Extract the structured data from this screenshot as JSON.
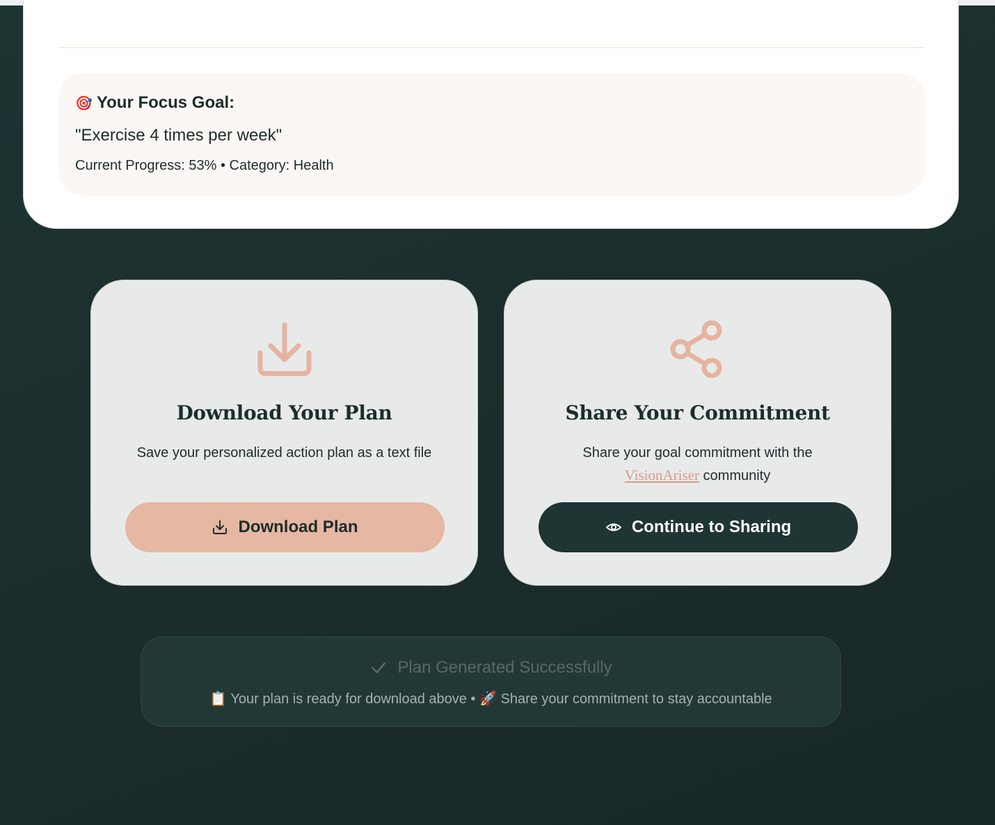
{
  "focus_goal": {
    "heading": "Your Focus Goal:",
    "dart_glyph": "🎯",
    "quote": "\"Exercise 4 times per week\"",
    "progress_label": "Current Progress:",
    "progress_value": "53%",
    "separator": "•",
    "category_label": "Category:",
    "category_value": "Health",
    "meta": "Current Progress: 53% • Category: Health"
  },
  "download_card": {
    "icon": "download-tray-icon",
    "title": "Download Your Plan",
    "description": "Save your personalized action plan as a text file",
    "button_label": "Download Plan"
  },
  "share_card": {
    "icon": "share-nodes-icon",
    "title": "Share Your Commitment",
    "description_before": "Share your goal commitment with the",
    "brand_link": "VisionAriser",
    "description_after": "community",
    "button_label": "Continue to Sharing"
  },
  "success": {
    "title": "Plan Generated Successfully",
    "line": "📋 Your plan is ready for download above • 🚀 Share your commitment to stay accountable"
  },
  "colors": {
    "background": "#1d3433",
    "accent_peach": "#e6b7a2",
    "icon_peach": "#e6b3a0",
    "dark_button": "#1e3534",
    "card_bg": "#e8eae9"
  }
}
